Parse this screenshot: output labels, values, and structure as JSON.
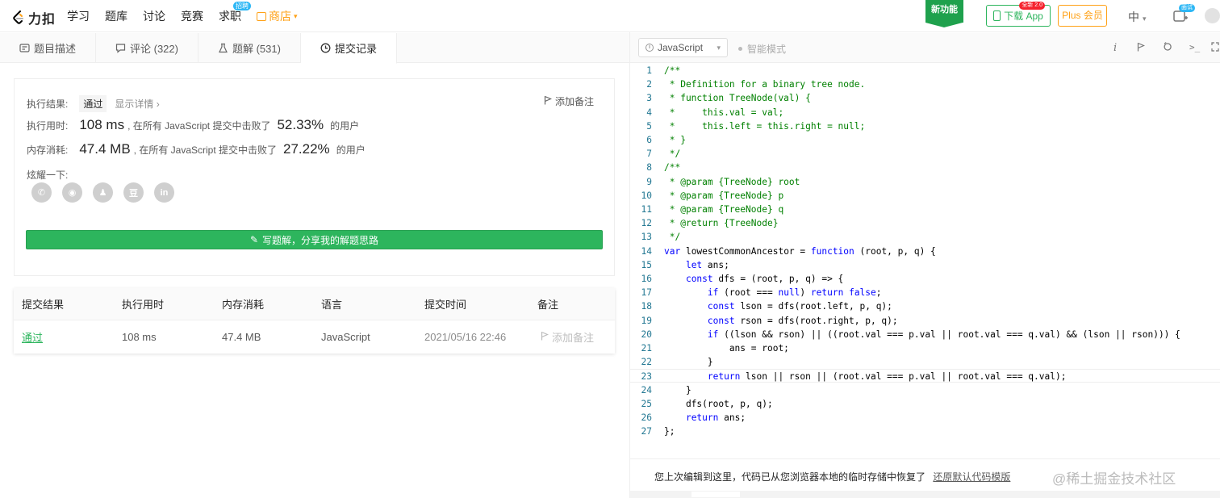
{
  "nav": {
    "logo_text": "力扣",
    "items": [
      "学习",
      "题库",
      "讨论",
      "竞赛",
      "求职"
    ],
    "job_badge": "招聘",
    "store": "商店",
    "new_feature": "新功能",
    "download_app": "下载 App",
    "app_badge": "全新 2.0",
    "plus": "Plus 会员",
    "lang": "中",
    "notify_badge": "面试"
  },
  "tabs": [
    {
      "label": "题目描述",
      "icon": "document-icon"
    },
    {
      "label": "评论 (322)",
      "icon": "comment-icon"
    },
    {
      "label": "题解 (531)",
      "icon": "flask-icon"
    },
    {
      "label": "提交记录",
      "icon": "clock-icon"
    }
  ],
  "result": {
    "label_result": "执行结果:",
    "status": "通过",
    "show_detail": "显示详情 ›",
    "add_note": "添加备注",
    "label_time": "执行用时:",
    "time_value": "108 ms",
    "time_mid": ", 在所有 JavaScript 提交中击败了",
    "time_pct": "52.33%",
    "users": "的用户",
    "label_mem": "内存消耗:",
    "mem_value": "47.4 MB",
    "mem_mid": ", 在所有 JavaScript 提交中击败了",
    "mem_pct": "27.22%",
    "share_label": "炫耀一下:",
    "share_icons": [
      "wechat-icon",
      "weibo-icon",
      "qq-icon",
      "douban-icon",
      "linkedin-icon"
    ],
    "share_glyphs": [
      "✆",
      "◉",
      "♟",
      "豆",
      "in"
    ],
    "write_solution": "写题解，分享我的解题思路"
  },
  "table": {
    "headers": [
      "提交结果",
      "执行用时",
      "内存消耗",
      "语言",
      "提交时间",
      "备注"
    ],
    "row": {
      "status": "通过",
      "time": "108 ms",
      "memory": "47.4 MB",
      "language": "JavaScript",
      "submitted": "2021/05/16 22:46",
      "note": "添加备注"
    }
  },
  "editor": {
    "language": "JavaScript",
    "smart_mode": "智能模式",
    "code": [
      "/**",
      " * Definition for a binary tree node.",
      " * function TreeNode(val) {",
      " *     this.val = val;",
      " *     this.left = this.right = null;",
      " * }",
      " */",
      "/**",
      " * @param {TreeNode} root",
      " * @param {TreeNode} p",
      " * @param {TreeNode} q",
      " * @return {TreeNode}",
      " */",
      "var lowestCommonAncestor = function (root, p, q) {",
      "    let ans;",
      "    const dfs = (root, p, q) => {",
      "        if (root === null) return false;",
      "        const lson = dfs(root.left, p, q);",
      "        const rson = dfs(root.right, p, q);",
      "        if ((lson && rson) || ((root.val === p.val || root.val === q.val) && (lson || rson))) {",
      "            ans = root;",
      "        }",
      "        return lson || rson || (root.val === p.val || root.val === q.val);",
      "    }",
      "    dfs(root, p, q);",
      "    return ans;",
      "};"
    ],
    "comment_lines": 13,
    "restore_msg": "您上次编辑到这里，代码已从您浏览器本地的临时存储中恢复了",
    "restore_link": "还原默认代码模版",
    "watermark": "@稀土掘金技术社区"
  }
}
